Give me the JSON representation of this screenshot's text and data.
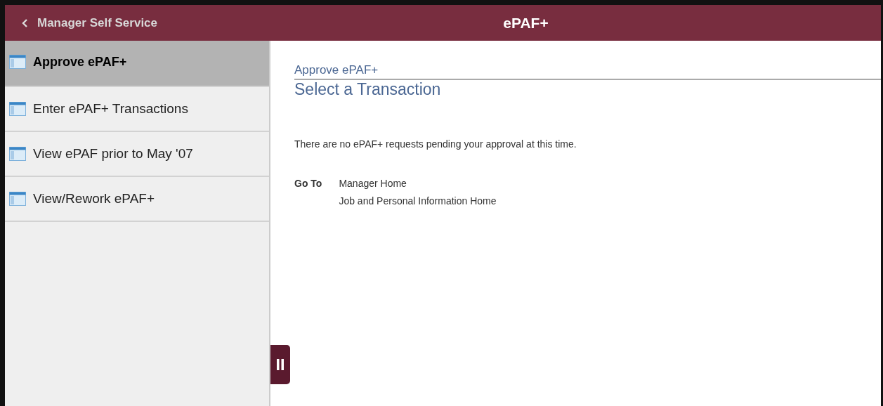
{
  "header": {
    "back_label": "Manager Self Service",
    "title": "ePAF+"
  },
  "sidebar": {
    "items": [
      {
        "label": "Approve ePAF+",
        "selected": true
      },
      {
        "label": "Enter ePAF+ Transactions",
        "selected": false
      },
      {
        "label": "View ePAF prior to May '07",
        "selected": false
      },
      {
        "label": "View/Rework ePAF+",
        "selected": false
      }
    ]
  },
  "content": {
    "breadcrumb": "Approve ePAF+",
    "heading": "Select a Transaction",
    "message": "There are no ePAF+ requests pending your approval at this time.",
    "goto_label": "Go To",
    "goto_links": [
      "Manager Home",
      "Job and Personal Information Home"
    ]
  }
}
